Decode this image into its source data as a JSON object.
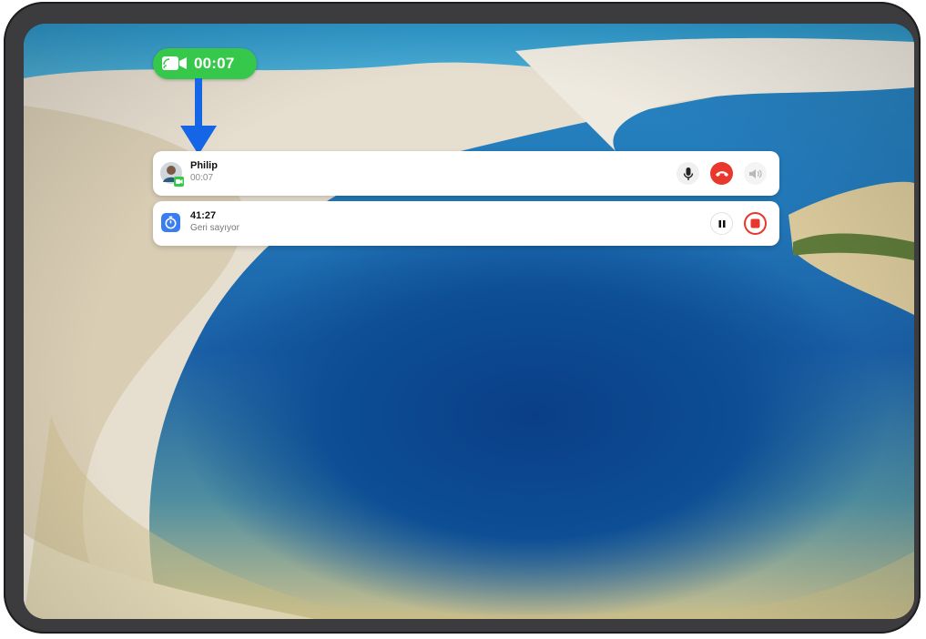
{
  "call_pill": {
    "icon": "video-call-icon",
    "duration": "00:07",
    "color": "#36c84b"
  },
  "call_card": {
    "contact_name": "Philip",
    "duration": "00:07",
    "avatar_icon": "avatar",
    "badge_icon": "video-badge-icon",
    "buttons": [
      "microphone-icon",
      "hang-up-icon",
      "speaker-icon"
    ]
  },
  "timer_card": {
    "icon": "timer-icon",
    "time": "41:27",
    "status": "Geri sayıyor",
    "buttons": [
      "pause-icon",
      "stop-icon"
    ]
  },
  "colors": {
    "hangup": "#e8372c",
    "timer_icon": "#3a7df0",
    "arrow": "#1566e6",
    "stop": "#e8372c"
  }
}
